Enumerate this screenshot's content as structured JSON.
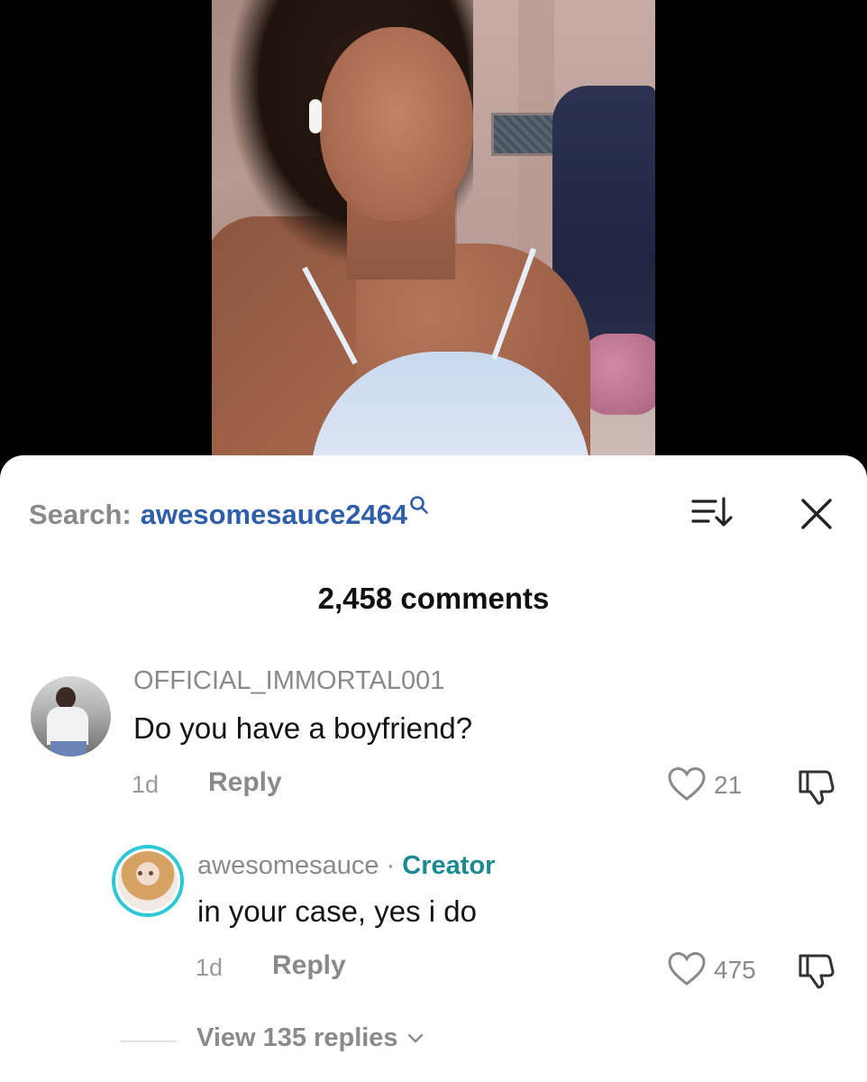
{
  "sheet": {
    "search_prefix": "Search:",
    "search_term": "awesomesauce2464",
    "comment_count": "2,458 comments"
  },
  "icons": {
    "search": "magnifier-icon",
    "sort": "sort-icon",
    "close": "close-icon",
    "like": "heart-icon",
    "dislike": "thumbs-down-icon",
    "expand": "chevron-down-icon"
  },
  "comments": [
    {
      "username": "OFFICIAL_IMMORTAL001",
      "text": "Do you have a boyfriend?",
      "time": "1d",
      "reply_label": "Reply",
      "likes": "21"
    },
    {
      "username": "awesomesauce",
      "separator": "·",
      "badge": "Creator",
      "text": "in your case, yes i do",
      "time": "1d",
      "reply_label": "Reply",
      "likes": "475"
    }
  ],
  "view_replies": "View 135 replies",
  "colors": {
    "link": "#2f5fa8",
    "creator": "#1c8a93",
    "muted": "#8a8a8a",
    "avatar_ring": "#2bc8d6"
  }
}
